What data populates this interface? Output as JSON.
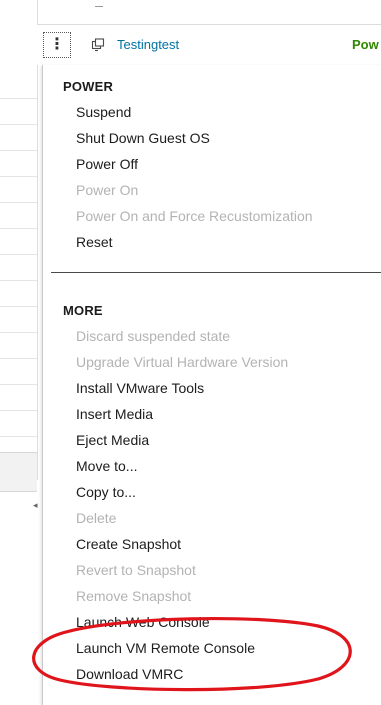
{
  "vm": {
    "name": "Testingtest",
    "state": "Pow",
    "kebab_glyph": "⋮",
    "icon": "vm-icon"
  },
  "menu": {
    "power": {
      "header": "POWER",
      "items": [
        {
          "label": "Suspend",
          "enabled": true
        },
        {
          "label": "Shut Down Guest OS",
          "enabled": true
        },
        {
          "label": "Power Off",
          "enabled": true
        },
        {
          "label": "Power On",
          "enabled": false
        },
        {
          "label": "Power On and Force Recustomization",
          "enabled": false
        },
        {
          "label": "Reset",
          "enabled": true
        }
      ]
    },
    "more": {
      "header": "MORE",
      "items": [
        {
          "label": "Discard suspended state",
          "enabled": false
        },
        {
          "label": "Upgrade Virtual Hardware Version",
          "enabled": false
        },
        {
          "label": "Install VMware Tools",
          "enabled": true
        },
        {
          "label": "Insert Media",
          "enabled": true
        },
        {
          "label": "Eject Media",
          "enabled": true
        },
        {
          "label": "Move to...",
          "enabled": true
        },
        {
          "label": "Copy to...",
          "enabled": true
        },
        {
          "label": "Delete",
          "enabled": false
        },
        {
          "label": "Create Snapshot",
          "enabled": true
        },
        {
          "label": "Revert to Snapshot",
          "enabled": false
        },
        {
          "label": "Remove Snapshot",
          "enabled": false
        },
        {
          "label": "Launch Web Console",
          "enabled": true
        },
        {
          "label": "Launch VM Remote Console",
          "enabled": true
        },
        {
          "label": "Download VMRC",
          "enabled": true
        }
      ]
    }
  },
  "colors": {
    "link": "#0072a3",
    "state_green": "#318700",
    "disabled_text": "#b3b3b3",
    "annotation_red": "#e0151b"
  }
}
